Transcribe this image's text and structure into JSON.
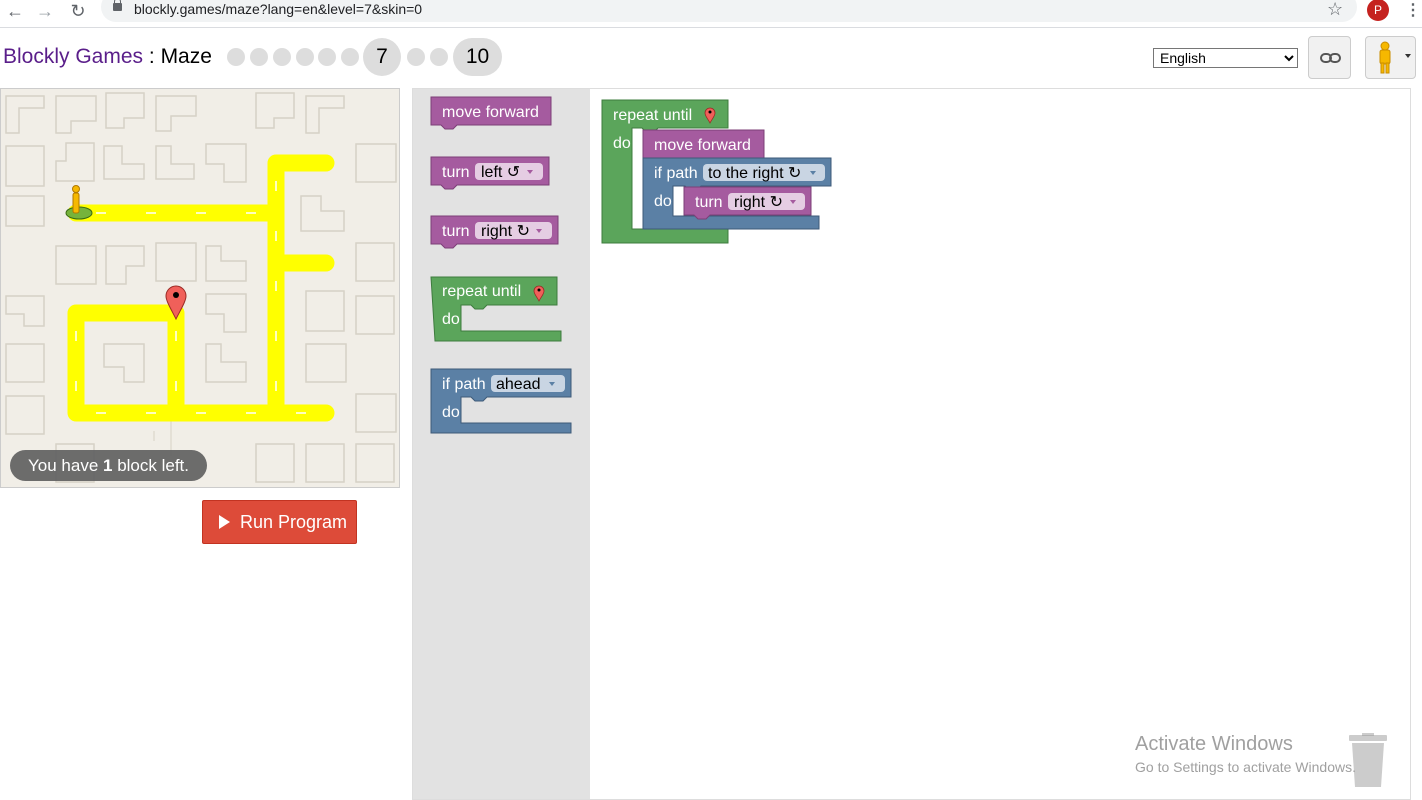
{
  "browser": {
    "url": "blockly.games/maze?lang=en&level=7&skin=0",
    "profile_initial": "P",
    "icons": [
      "back-icon",
      "forward-icon",
      "reload-icon",
      "lock-icon",
      "star-icon",
      "menu-icon"
    ]
  },
  "header": {
    "brand": "Blockly Games",
    "separator": " : ",
    "app": "Maze",
    "levels": [
      "1",
      "2",
      "3",
      "4",
      "5",
      "6",
      "7",
      "8",
      "9",
      "10"
    ],
    "current_level": "7",
    "last_level": "10",
    "language": "English"
  },
  "maze": {
    "capacity_prefix": "You have ",
    "capacity_count": "1",
    "capacity_suffix": " block left."
  },
  "run_label": "Run Program",
  "toolbox": {
    "move_forward": "move forward",
    "turn": "turn",
    "left": "left ↺",
    "right": "right ↻",
    "repeat_until": "repeat until",
    "do": "do",
    "if_path": "if path",
    "ahead": "ahead"
  },
  "program": {
    "repeat_until": "repeat until",
    "do": "do",
    "move_forward": "move forward",
    "if_path": "if path",
    "direction": "to the right ↻",
    "turn": "turn",
    "turn_dir": "right ↻"
  },
  "watermark": {
    "title": "Activate Windows",
    "subtitle": "Go to Settings to activate Windows."
  },
  "colors": {
    "movement_block": "#a55b9f",
    "loop_block": "#5ba55b",
    "logic_block": "#5b80a5",
    "path": "#ffff00",
    "run_button": "#dd4b39"
  }
}
